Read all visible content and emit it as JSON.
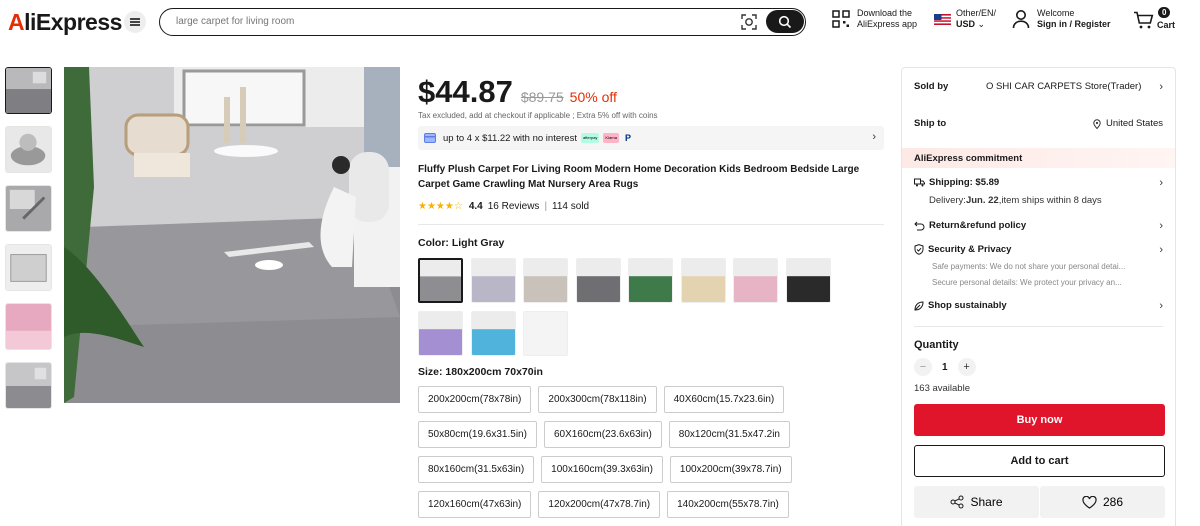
{
  "header": {
    "logo": "AliExpress",
    "search_placeholder": "large carpet for living room",
    "download_line1": "Download the",
    "download_line2": "AliExpress app",
    "region_line1": "Other/EN/",
    "region_line2": "USD",
    "welcome_line1": "Welcome",
    "welcome_line2": "Sign in / Register",
    "cart_count": "0",
    "cart_label": "Cart"
  },
  "product": {
    "price": "$44.87",
    "original_price": "$89.75",
    "discount": "50% off",
    "tax_note": "Tax excluded, add at checkout if applicable ; Extra 5% off with coins",
    "installment": "up to 4 x $11.22 with no interest",
    "installment_badges": [
      "afterpay",
      "Klarna",
      "P"
    ],
    "title": "Fluffy Plush Carpet For Living Room Modern Home Decoration Kids Bedroom Bedside Large Carpet Game Crawling Mat Nursery Area Rugs",
    "rating": 4.4,
    "rating_text": "4.4",
    "reviews": "16 Reviews",
    "sold": "114 sold",
    "color_label": "Color: Light Gray",
    "swatch_colors": [
      "#8e8e92",
      "#b9b6c8",
      "#c9c2bb",
      "#6f6f73",
      "#3f7a4b",
      "#e3d3b0",
      "#e7b4c6",
      "#2a2a2a",
      "#a48fd3",
      "#4fb3dc",
      "#f4f4f4"
    ],
    "size_label": "Size: 180x200cm 70x70in",
    "sizes": [
      [
        "200x200cm(78x78in)",
        "200x300cm(78x118in)",
        "40X60cm(15.7x23.6in)"
      ],
      [
        "50x80cm(19.6x31.5in)",
        "60X160cm(23.6x63in)",
        "80x120cm(31.5x47.2in"
      ],
      [
        "80x160cm(31.5x63in)",
        "100x160cm(39.3x63in)",
        "100x200cm(39x78.7in)"
      ],
      [
        "120x160cm(47x63in)",
        "120x200cm(47x78.7in)",
        "140x200cm(55x78.7in)"
      ]
    ]
  },
  "sidebar": {
    "sold_by_label": "Sold by",
    "store": "O SHI CAR CARPETS Store(Trader)",
    "ship_to_label": "Ship to",
    "ship_to": "United States",
    "commitment": "AliExpress commitment",
    "shipping_label": "Shipping: $5.89",
    "delivery_prefix": "Delivery: ",
    "delivery_date": "Jun. 22",
    "delivery_suffix": " ,item ships within 8 days",
    "return_policy": "Return&refund policy",
    "security": "Security & Privacy",
    "security_note1": "Safe payments: We do not share your personal detai...",
    "security_note2": "Secure personal details: We protect your privacy an...",
    "sustainably": "Shop sustainably",
    "quantity_label": "Quantity",
    "quantity": "1",
    "available": "163 available",
    "buy_now": "Buy now",
    "add_to_cart": "Add to cart",
    "share": "Share",
    "wishlist_count": "286"
  },
  "colors": {
    "accent_red": "#e0142a",
    "discount_red": "#e62e04",
    "star_yellow": "#f4b400"
  }
}
